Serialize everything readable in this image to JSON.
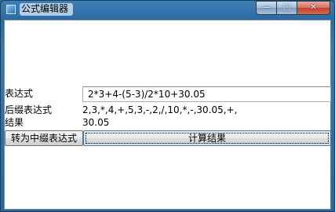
{
  "window": {
    "title": "公式编辑器",
    "icon": "app-icon",
    "caption_buttons": {
      "minimize": "—",
      "maximize": "□",
      "close": "✕"
    }
  },
  "form": {
    "expression_label": "表达式",
    "expression_value": "2*3+4-(5-3)/2*10+30.05",
    "postfix_label": "后缀表达式",
    "postfix_value": "2,3,*,4,+,5,3,-,2,/,10,*,-,30.05,+,",
    "result_label": "结果",
    "result_value": "30.05"
  },
  "buttons": {
    "to_infix": "转为中缀表达式",
    "calculate": "计算结果"
  }
}
